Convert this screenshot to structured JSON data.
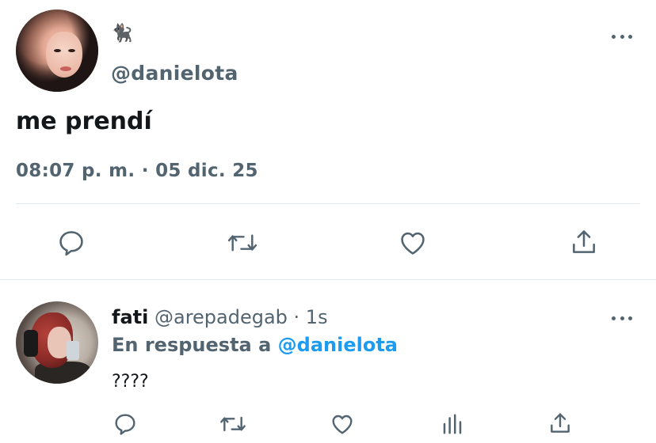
{
  "main_tweet": {
    "display_name": "🐈‍⬛",
    "handle": "@danielota",
    "text": "me prendí",
    "timestamp": "08:07 p. m. · 05 dic. 25",
    "actions": [
      "reply-icon",
      "retweet-icon",
      "like-icon",
      "share-icon"
    ]
  },
  "reply": {
    "name": "fati",
    "meta": "@arepadegab · 1s",
    "in_reply_prefix": "En respuesta a",
    "in_reply_mention": "@danielota",
    "text": "????",
    "actions": [
      "reply-icon",
      "retweet-icon",
      "like-icon",
      "analytics-icon",
      "share-icon"
    ]
  },
  "colors": {
    "text_primary": "#14171a",
    "text_secondary": "#536471",
    "accent": "#1d9bf0",
    "divider": "#e1e8ed"
  }
}
